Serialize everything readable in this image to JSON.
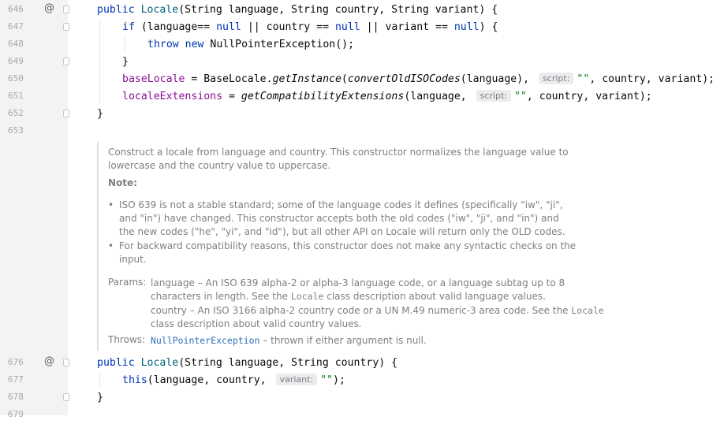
{
  "gutter": {
    "lines": [
      {
        "num": "646",
        "mark": "@"
      },
      {
        "num": "647",
        "mark": ""
      },
      {
        "num": "648",
        "mark": ""
      },
      {
        "num": "649",
        "mark": ""
      },
      {
        "num": "650",
        "mark": ""
      },
      {
        "num": "651",
        "mark": ""
      },
      {
        "num": "652",
        "mark": ""
      },
      {
        "num": "653",
        "mark": ""
      },
      {
        "num": "676",
        "mark": "@"
      },
      {
        "num": "677",
        "mark": ""
      },
      {
        "num": "678",
        "mark": ""
      },
      {
        "num": "679",
        "mark": ""
      }
    ]
  },
  "code": {
    "l646": {
      "kw1": "public ",
      "ctor": "Locale",
      "rest": "(String language, String country, String variant) {"
    },
    "l647": {
      "kw1": "if",
      "a": " (language== ",
      "n1": "null",
      "b": " || country == ",
      "n2": "null",
      "c": " || variant == ",
      "n3": "null",
      "d": ") {"
    },
    "l648": {
      "kw1": "throw ",
      "kw2": "new ",
      "rest": "NullPointerException();"
    },
    "l649": {
      "text": "}"
    },
    "l650": {
      "field": "baseLocale",
      "a": " = BaseLocale.",
      "m1": "getInstance",
      "b": "(",
      "m2": "convertOldISOCodes",
      "c": "(language), ",
      "hint": "script:",
      "str": "\"\"",
      "d": ", country, variant);"
    },
    "l651": {
      "field": "localeExtensions",
      "a": " = ",
      "m1": "getCompatibilityExtensions",
      "b": "(language, ",
      "hint": "script:",
      "str": "\"\"",
      "c": ", country, variant);"
    },
    "l652": {
      "text": "}"
    },
    "l676": {
      "kw1": "public ",
      "ctor": "Locale",
      "rest": "(String language, String country) {"
    },
    "l677": {
      "kw1": "this",
      "a": "(language, country, ",
      "hint": "variant:",
      "str": "\"\"",
      "b": ");"
    },
    "l678": {
      "text": "}"
    }
  },
  "doc": {
    "para": "Construct a locale from language and country. This constructor normalizes the language value to lowercase and the country value to uppercase.",
    "note_label": "Note:",
    "bullets": [
      "ISO 639 is not a stable standard; some of the language codes it defines (specifically \"iw\", \"ji\", and \"in\") have changed. This constructor accepts both the old codes (\"iw\", \"ji\", and \"in\") and the new codes (\"he\", \"yi\", and \"id\"), but all other API on Locale will return only the OLD codes.",
      "For backward compatibility reasons, this constructor does not make any syntactic checks on the input."
    ],
    "bullet_char": "•",
    "params_label": "Params:",
    "params": [
      {
        "pre": "language – An ISO 639 alpha-2 or alpha-3 language code, or a language subtag up to 8 characters in length. See the ",
        "code": "Locale",
        "post": " class description about valid language values."
      },
      {
        "pre": "country – An ISO 3166 alpha-2 country code or a UN M.49 numeric-3 area code. See the ",
        "code": "Locale",
        "post": " class description about valid country values."
      }
    ],
    "throws_label": "Throws:",
    "throws_link": "NullPointerException",
    "throws_text": " – thrown if either argument is null."
  }
}
